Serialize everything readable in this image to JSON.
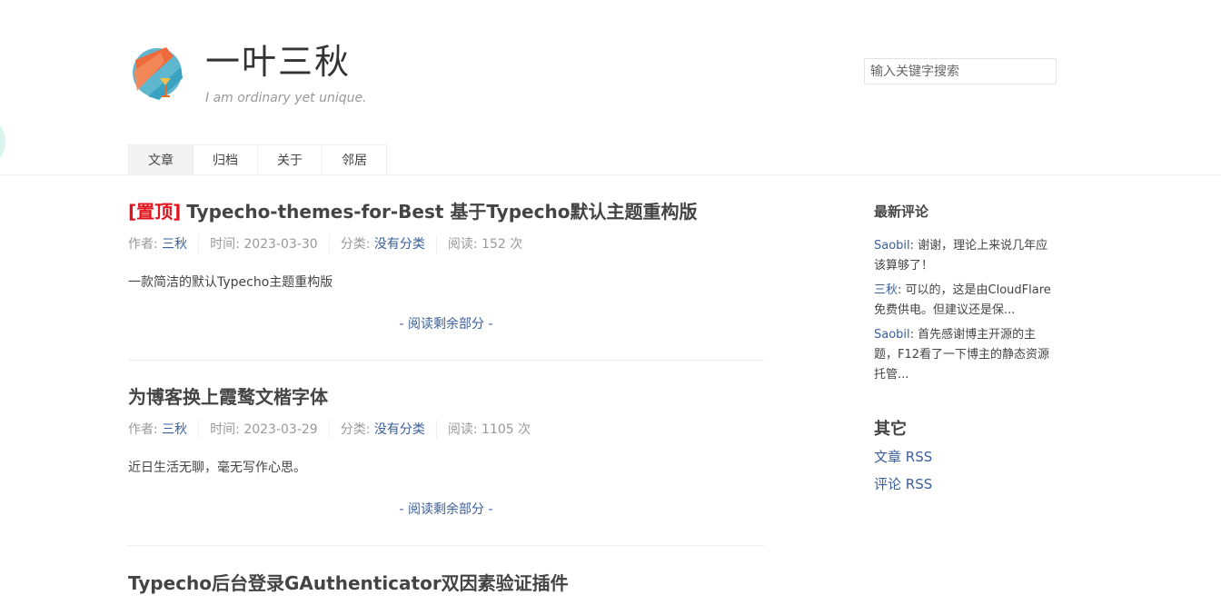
{
  "site": {
    "title": "一叶三秋",
    "description": "I am ordinary yet unique."
  },
  "search": {
    "placeholder": "输入关键字搜索"
  },
  "nav": {
    "items": [
      {
        "label": "文章"
      },
      {
        "label": "归档"
      },
      {
        "label": "关于"
      },
      {
        "label": "邻居"
      }
    ]
  },
  "posts": [
    {
      "sticky": "[置顶]",
      "title": "Typecho-themes-for-Best 基于Typecho默认主题重构版",
      "author_label": "作者: ",
      "author": "三秋",
      "time": "时间: 2023-03-30",
      "category_label": "分类: ",
      "category": "没有分类",
      "reads": "阅读: 152 次",
      "excerpt": "一款简洁的默认Typecho主题重构版",
      "read_more": "- 阅读剩余部分 -"
    },
    {
      "title": "为博客换上霞鹜文楷字体",
      "author_label": "作者: ",
      "author": "三秋",
      "time": "时间: 2023-03-29",
      "category_label": "分类: ",
      "category": "没有分类",
      "reads": "阅读: 1105 次",
      "excerpt": "近日生活无聊，毫无写作心思。",
      "read_more": "- 阅读剩余部分 -"
    },
    {
      "title": "Typecho后台登录GAuthenticator双因素验证插件"
    }
  ],
  "sidebar": {
    "recent_comments_title": "最新评论",
    "comments": [
      {
        "author": "Saobil",
        "text": ": 谢谢，理论上来说几年应该算够了！"
      },
      {
        "author": "三秋",
        "text": ": 可以的，这是由CloudFlare免费供电。但建议还是保..."
      },
      {
        "author": "Saobil",
        "text": ": 首先感谢博主开源的主题，F12看了一下博主的静态资源托管..."
      }
    ],
    "other_title": "其它",
    "links": [
      {
        "label": "文章 RSS"
      },
      {
        "label": "评论 RSS"
      }
    ]
  }
}
